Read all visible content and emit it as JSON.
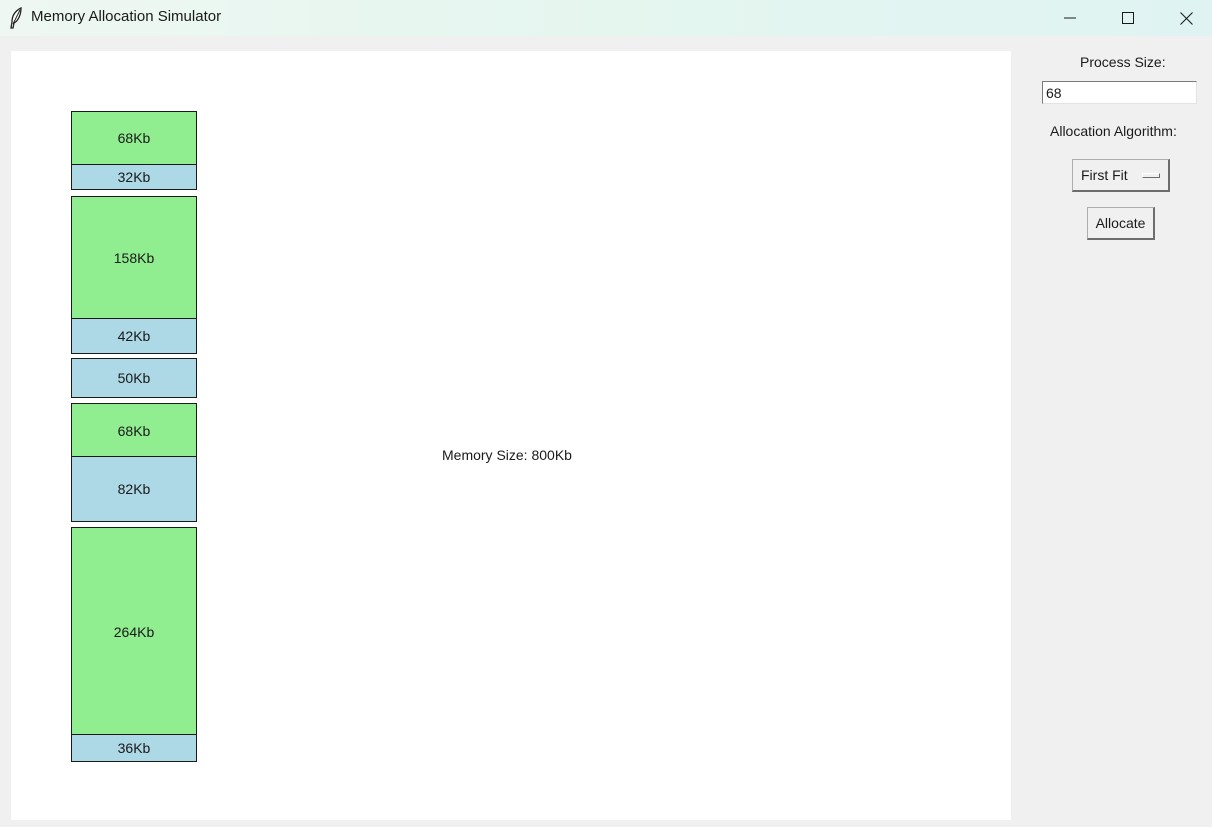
{
  "window": {
    "title": "Memory Allocation Simulator",
    "controls": [
      "minimize-icon",
      "maximize-icon",
      "close-icon"
    ]
  },
  "memory": {
    "size_label": "Memory Size: 800Kb",
    "blocks": [
      {
        "label": "68Kb",
        "size_kb": 68,
        "state": "allocated"
      },
      {
        "label": "32Kb",
        "size_kb": 32,
        "state": "free"
      },
      {
        "label": "158Kb",
        "size_kb": 158,
        "state": "allocated"
      },
      {
        "label": "42Kb",
        "size_kb": 42,
        "state": "free"
      },
      {
        "label": "50Kb",
        "size_kb": 50,
        "state": "free"
      },
      {
        "label": "68Kb",
        "size_kb": 68,
        "state": "allocated"
      },
      {
        "label": "82Kb",
        "size_kb": 82,
        "state": "free"
      },
      {
        "label": "264Kb",
        "size_kb": 264,
        "state": "allocated"
      },
      {
        "label": "36Kb",
        "size_kb": 36,
        "state": "free"
      }
    ]
  },
  "colors": {
    "allocated": "#90ee90",
    "free": "#add8e6"
  },
  "panel": {
    "process_size_label": "Process Size:",
    "process_size_value": "68",
    "algorithm_label": "Allocation Algorithm:",
    "algorithm_selected": "First Fit",
    "allocate_label": "Allocate"
  }
}
